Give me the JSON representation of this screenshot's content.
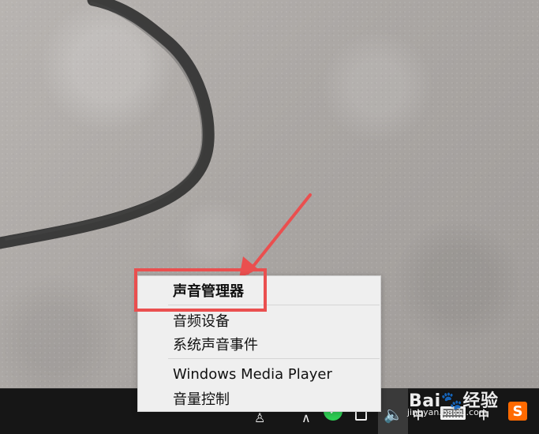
{
  "background": {
    "pen_stroke_color": "#2f2f2f"
  },
  "context_menu": {
    "items": [
      {
        "label": "声音管理器",
        "bold": true
      },
      {
        "label": "音频设备",
        "bold": false
      },
      {
        "label": "系统声音事件",
        "bold": false
      },
      {
        "label": "Windows Media Player",
        "bold": false
      },
      {
        "label": "音量控制",
        "bold": false
      }
    ],
    "highlighted_item": "声音管理器"
  },
  "annotations": {
    "highlight_color": "#ea4f4f"
  },
  "taskbar": {
    "tray_icons": [
      {
        "name": "person-icon",
        "glyph": "♙"
      },
      {
        "name": "network-icon",
        "glyph": "∧"
      },
      {
        "name": "wechat-icon",
        "glyph": "✓"
      },
      {
        "name": "battery-icon",
        "glyph": ""
      },
      {
        "name": "speaker-icon",
        "glyph": "🔈"
      },
      {
        "name": "ime-icon",
        "glyph": "中"
      },
      {
        "name": "keyboard-icon",
        "glyph": ""
      },
      {
        "name": "ime-secondary-icon",
        "glyph": "中"
      }
    ]
  },
  "watermark": {
    "line1": "Bai🐾经验",
    "line2": "jingyan.baidu.com"
  },
  "logo": {
    "text": "S"
  }
}
